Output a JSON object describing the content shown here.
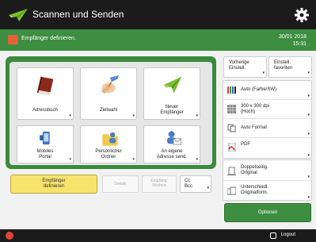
{
  "header": {
    "title": "Scannen und Senden"
  },
  "status": {
    "message": "Empfänger definieren.",
    "date": "30/01 2018",
    "time": "15:31"
  },
  "destinations": [
    {
      "label": "Adressbuch"
    },
    {
      "label": "Zielwahl"
    },
    {
      "label": "Neuer\nEmpfänger"
    },
    {
      "label": "Mobiles\nPortal"
    },
    {
      "label": "Persönlicher\nOrdner"
    },
    {
      "label": "An eigene\nAdresse send."
    }
  ],
  "bottom_left": {
    "define_button": "Empfänger\ndefinieren",
    "details_button": "Details",
    "delete_button": "Empfäng.\nlöschen",
    "cc_button": "Cc\nBcc"
  },
  "right": {
    "preset_button": "Vorherige\nEinstell.",
    "favorites_button": "Einstell.\nfavoriten",
    "color_mode": "Auto (Farbe/SW)",
    "resolution": "300 x 300 dpi\n(Hoch)",
    "paper_format": "Auto Format",
    "file_type": "PDF",
    "duplex": "Doppelseitig.\nOriginal",
    "mixed": "Unterschiedl.\nOriginalform.",
    "options_button": "Optionen"
  },
  "footer": {
    "logout_label": "Logout"
  },
  "colors": {
    "accent_green": "#3e8e41",
    "highlight_yellow": "#f7e36b",
    "bar_dark": "#1b1b1b"
  }
}
